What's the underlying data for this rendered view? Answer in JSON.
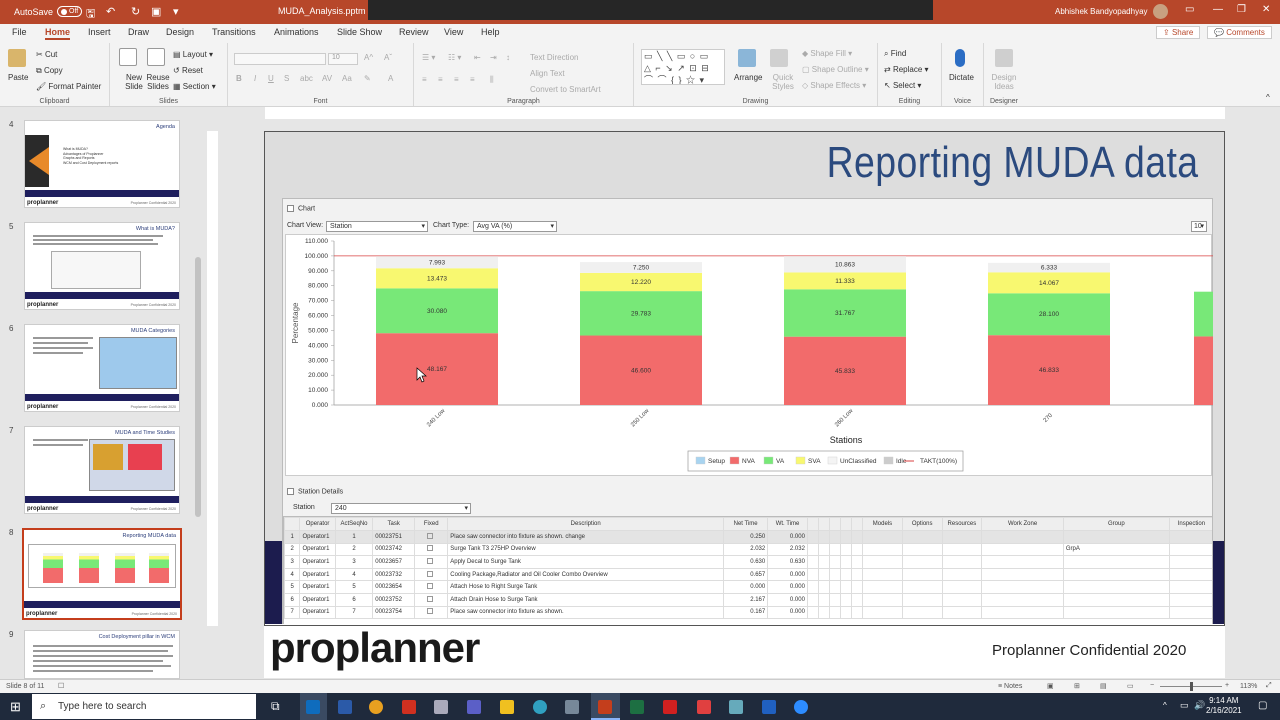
{
  "titlebar": {
    "autosave": "AutoSave",
    "autosave_state": "Off",
    "filename": "MUDA_Analysis.pptm  -  S",
    "user": "Abhishek Bandyopadhyay"
  },
  "menu": {
    "tabs": [
      "File",
      "Home",
      "Insert",
      "Draw",
      "Design",
      "Transitions",
      "Animations",
      "Slide Show",
      "Review",
      "View",
      "Help"
    ],
    "share": "Share",
    "comments": "Comments"
  },
  "ribbon": {
    "clipboard": {
      "label": "Clipboard",
      "paste": "Paste",
      "cut": "Cut",
      "copy": "Copy",
      "format_painter": "Format Painter"
    },
    "slides": {
      "label": "Slides",
      "new_slide": "New Slide",
      "reuse_slides": "Reuse Slides",
      "layout": "Layout",
      "reset": "Reset",
      "section": "Section"
    },
    "font": {
      "label": "Font",
      "size": "10"
    },
    "paragraph": {
      "label": "Paragraph",
      "text_direction": "Text Direction",
      "align_text": "Align Text",
      "convert": "Convert to SmartArt"
    },
    "drawing": {
      "label": "Drawing",
      "arrange": "Arrange",
      "quick_styles": "Quick Styles",
      "shape_fill": "Shape Fill",
      "shape_outline": "Shape Outline",
      "shape_effects": "Shape Effects"
    },
    "editing": {
      "label": "Editing",
      "find": "Find",
      "replace": "Replace",
      "select": "Select"
    },
    "voice": {
      "label": "Voice",
      "dictate": "Dictate"
    },
    "designer": {
      "label": "Designer",
      "design_ideas": "Design Ideas"
    }
  },
  "thumbnails": [
    {
      "num": "4",
      "title": "Agenda"
    },
    {
      "num": "5",
      "title": "What is MUDA?"
    },
    {
      "num": "6",
      "title": "MUDA Categories"
    },
    {
      "num": "7",
      "title": "MUDA and Time Studies"
    },
    {
      "num": "8",
      "title": "Reporting MUDA data"
    },
    {
      "num": "9",
      "title": "Cost Deployment pillar in WCM"
    }
  ],
  "thumb_logo": "proplanner",
  "thumb_conf": "Proplanner Confidential 2020",
  "thumb_agenda_lines": [
    "What is MUDA?",
    "Advantages of Proplanner",
    "Graphs and Reports",
    "WCM and Cost Deployment reports"
  ],
  "slide": {
    "title": "Reporting MUDA data",
    "logo": "proplanner",
    "confidential": "Proplanner Confidential 2020",
    "chart_panel": {
      "header": "Chart",
      "chart_view_label": "Chart View:",
      "chart_view": "Station",
      "chart_type_label": "Chart Type:",
      "chart_type": "Avg VA (%)",
      "count": "10"
    },
    "station_panel": {
      "header": "Station Details",
      "station_label": "Station",
      "station_value": "240"
    },
    "table": {
      "headers": [
        "",
        "Operator",
        "ActSeqNo",
        "Task",
        "Fixed",
        "Description",
        "Net Time",
        "Wt. Time",
        "",
        "",
        "",
        "",
        "",
        "Models",
        "Options",
        "Resources",
        "Work Zone",
        "Group",
        "Inspection"
      ],
      "rows": [
        {
          "n": "1",
          "op": "Operator1",
          "seq": "1",
          "task": "00023751",
          "desc": "Place saw connector into fixture as shown. change",
          "net": "0.250",
          "wt": "0.000",
          "group": ""
        },
        {
          "n": "2",
          "op": "Operator1",
          "seq": "2",
          "task": "00023742",
          "desc": "Surge Tank T3  275HP Overview",
          "net": "2.032",
          "wt": "2.032",
          "group": "GrpA"
        },
        {
          "n": "3",
          "op": "Operator1",
          "seq": "3",
          "task": "00023657",
          "desc": "Apply Decal to Surge Tank",
          "net": "0.630",
          "wt": "0.630",
          "group": ""
        },
        {
          "n": "4",
          "op": "Operator1",
          "seq": "4",
          "task": "00023732",
          "desc": "Cooling Package,Radiator and Oil Cooler Combo Overview",
          "net": "0.657",
          "wt": "0.000",
          "group": ""
        },
        {
          "n": "5",
          "op": "Operator1",
          "seq": "5",
          "task": "00023654",
          "desc": "Attach Hose to Right Surge Tank",
          "net": "0.000",
          "wt": "0.000",
          "group": ""
        },
        {
          "n": "6",
          "op": "Operator1",
          "seq": "6",
          "task": "00023752",
          "desc": "Attach Drain Hose to Surge Tank",
          "net": "2.167",
          "wt": "0.000",
          "group": ""
        },
        {
          "n": "7",
          "op": "Operator1",
          "seq": "7",
          "task": "00023754",
          "desc": "Place saw connector into fixture as shown.",
          "net": "0.167",
          "wt": "0.000",
          "group": ""
        }
      ]
    }
  },
  "chart_data": {
    "type": "bar",
    "stacked": true,
    "categories": [
      "240 Low",
      "250 Low",
      "260 Low",
      "270"
    ],
    "xlabel": "Stations",
    "ylabel": "Percentage",
    "ylim": [
      0,
      110
    ],
    "yticks": [
      "0.000",
      "10.000",
      "20.000",
      "30.000",
      "40.000",
      "50.000",
      "60.000",
      "70.000",
      "80.000",
      "90.000",
      "100.000",
      "110.000"
    ],
    "series": [
      {
        "name": "NVA",
        "color": "#f26b6b",
        "values": [
          48.167,
          46.6,
          45.833,
          46.833
        ]
      },
      {
        "name": "VA",
        "color": "#78e878",
        "values": [
          30.08,
          29.783,
          31.767,
          28.1
        ]
      },
      {
        "name": "SVA",
        "color": "#f8f870",
        "values": [
          13.473,
          12.22,
          11.333,
          14.067
        ]
      },
      {
        "name": "UnClassified",
        "color": "#f0f0f0",
        "values": [
          7.993,
          7.25,
          10.863,
          6.333
        ]
      }
    ],
    "value_labels": [
      [
        "48.167",
        "46.600",
        "45.833",
        "46.833"
      ],
      [
        "30.080",
        "29.783",
        "31.767",
        "28.100"
      ],
      [
        "13.473",
        "12.220",
        "11.333",
        "14.067"
      ],
      [
        "7.993",
        "7.250",
        "10.863",
        "6.333"
      ]
    ],
    "legend": [
      "Setup",
      "NVA",
      "VA",
      "SVA",
      "UnClassified",
      "Idle",
      "TAKT(100%)"
    ],
    "legend_colors": [
      "#a8d4f0",
      "#f26b6b",
      "#78e878",
      "#f8f870",
      "#f4f4f4",
      "#cccccc",
      "#d84040"
    ],
    "takt": 100,
    "legend_position": "bottom"
  },
  "statusbar": {
    "slide_info": "Slide 8 of 11",
    "notes": "Notes",
    "zoom": "113%"
  },
  "taskbar": {
    "search": "Type here to search",
    "time": "9:14 AM",
    "date": "2/16/2021"
  }
}
